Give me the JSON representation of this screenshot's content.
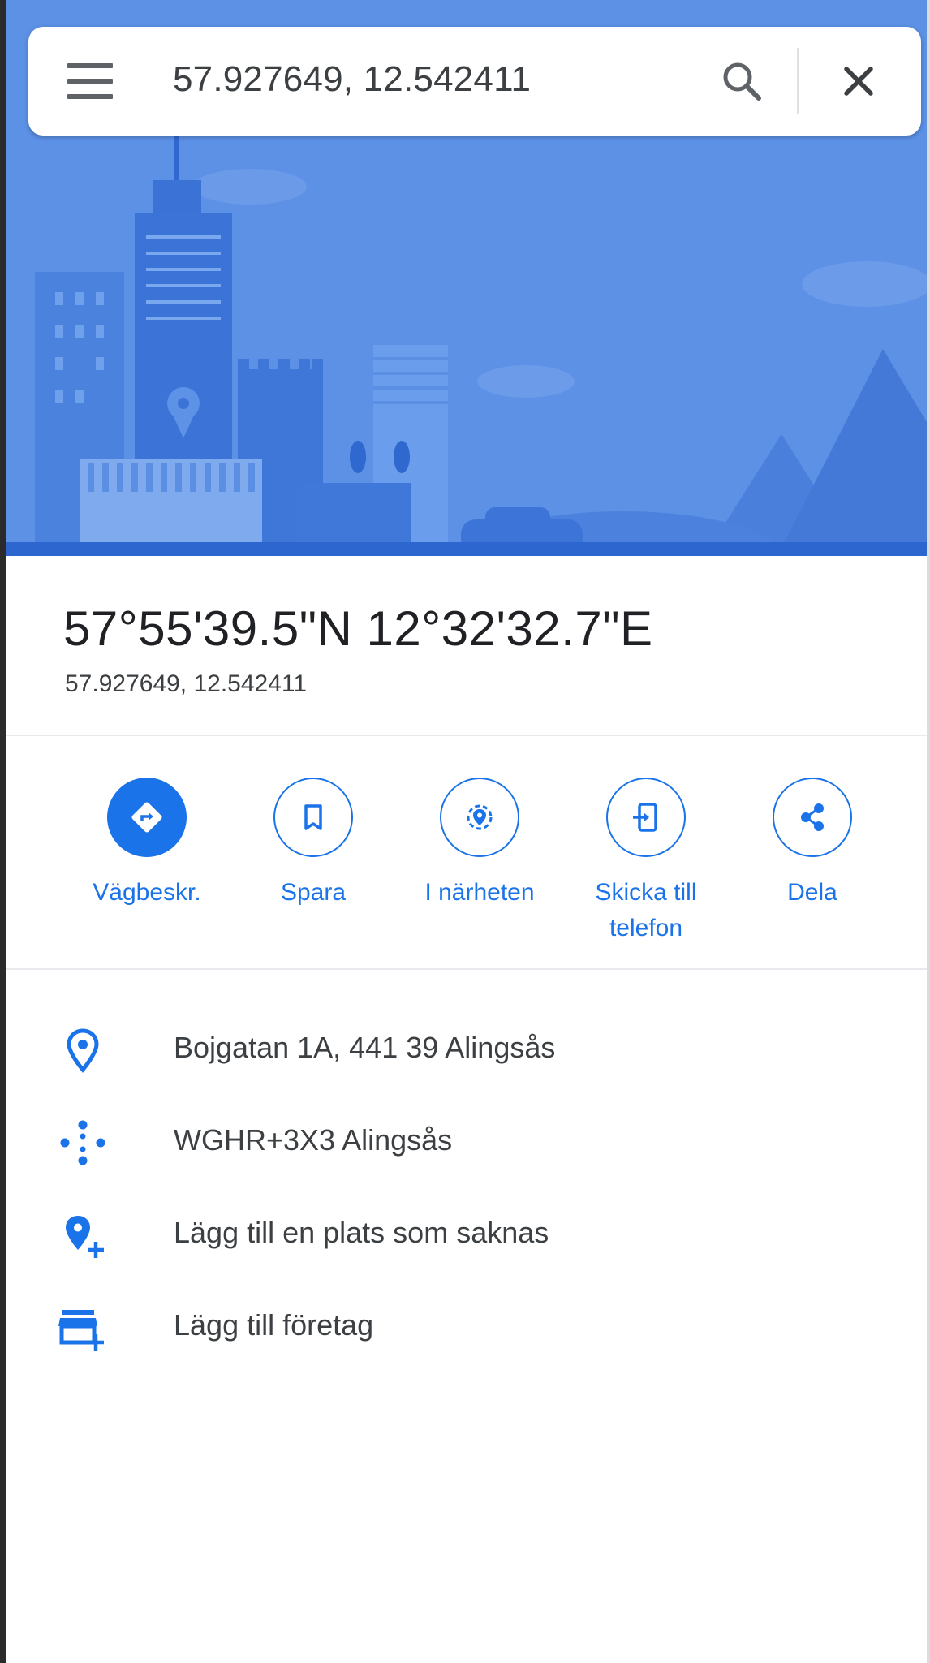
{
  "search": {
    "query": "57.927649, 12.542411"
  },
  "place": {
    "title": "57°55'39.5\"N 12°32'32.7\"E",
    "subtitle": "57.927649, 12.542411"
  },
  "actions": [
    {
      "label": "Vägbeskr.",
      "icon": "directions-icon"
    },
    {
      "label": "Spara",
      "icon": "bookmark-icon"
    },
    {
      "label": "I närheten",
      "icon": "nearby-icon"
    },
    {
      "label": "Skicka till\ntelefon",
      "icon": "send-to-phone-icon"
    },
    {
      "label": "Dela",
      "icon": "share-icon"
    }
  ],
  "info_rows": [
    {
      "text": "Bojgatan 1A, 441 39 Alingsås",
      "icon": "location-pin-icon"
    },
    {
      "text": "WGHR+3X3 Alingsås",
      "icon": "plus-code-icon"
    },
    {
      "text": "Lägg till en plats som saknas",
      "icon": "add-place-icon"
    },
    {
      "text": "Lägg till företag",
      "icon": "add-business-icon"
    }
  ],
  "colors": {
    "accent": "#1a73e8",
    "hero_bg": "#5a8fe3",
    "text": "#202124"
  }
}
